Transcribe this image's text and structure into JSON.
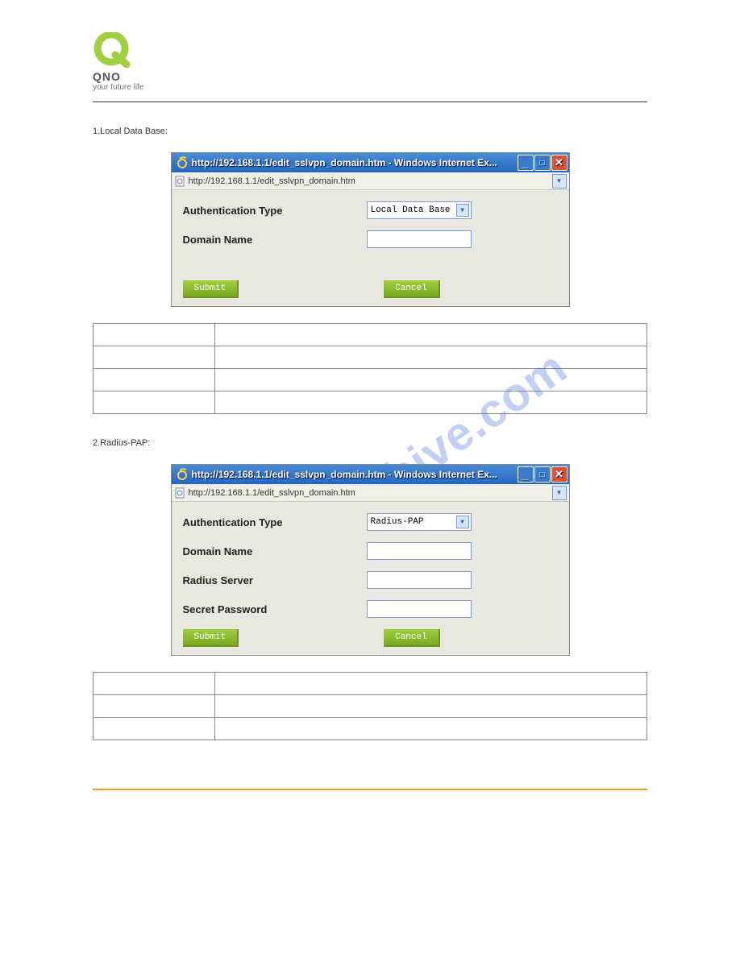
{
  "brand": {
    "name": "QNO",
    "tagline": "your future life"
  },
  "subtitles": {
    "s1": "1.Local Data Base:",
    "s2": "2.Radius-PAP:"
  },
  "window_title": "http://192.168.1.1/edit_sslvpn_domain.htm - Windows Internet Ex...",
  "address_url": "http://192.168.1.1/edit_sslvpn_domain.htm",
  "labels": {
    "auth_type": "Authentication Type",
    "domain_name": "Domain Name",
    "radius_server": "Radius Server",
    "secret_password": "Secret Password"
  },
  "select_values": {
    "local": "Local Data Base",
    "radius_pap": "Radius-PAP"
  },
  "buttons": {
    "submit": "Submit",
    "cancel": "Cancel"
  },
  "watermark": "manualshive.com"
}
